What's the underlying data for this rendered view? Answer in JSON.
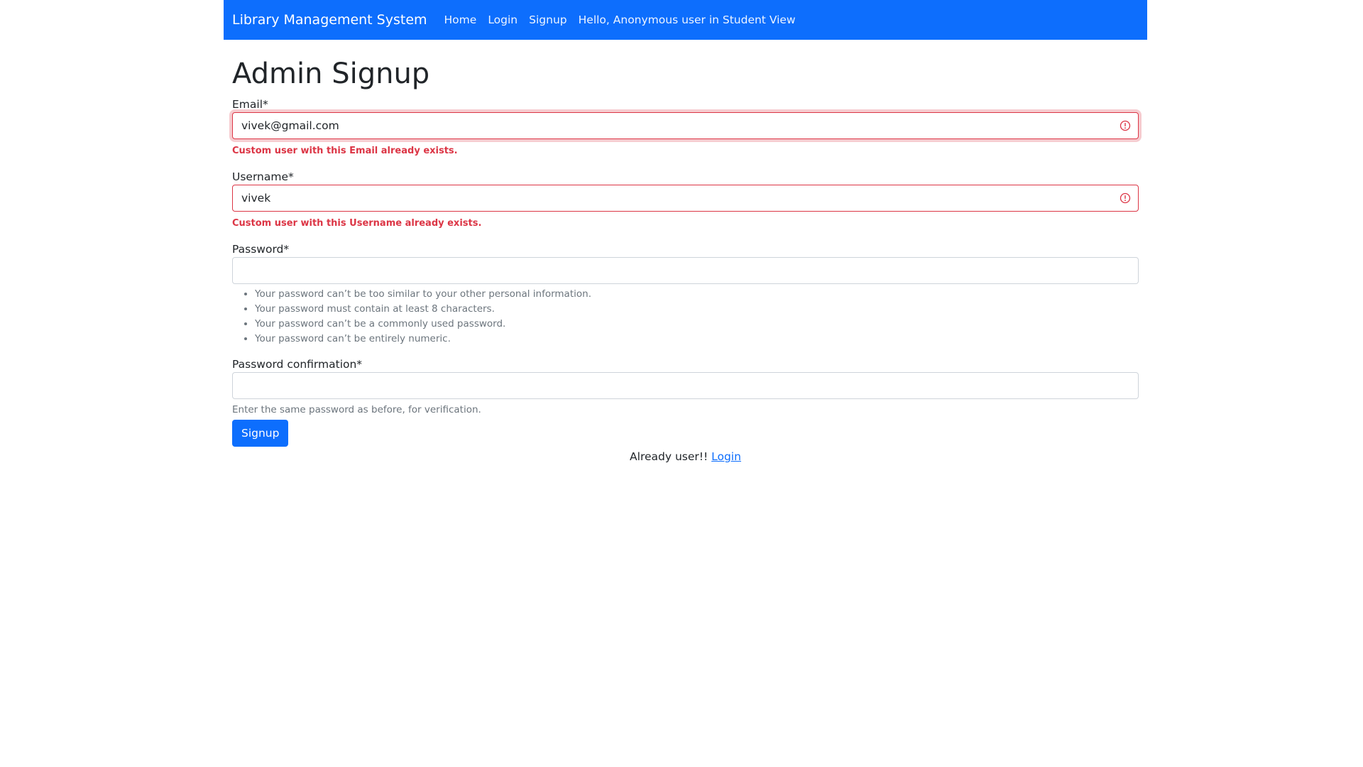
{
  "navbar": {
    "brand": "Library Management System",
    "links": [
      "Home",
      "Login",
      "Signup"
    ],
    "greeting": "Hello, Anonymous user in Student View"
  },
  "page_title": "Admin Signup",
  "form": {
    "email": {
      "label": "Email*",
      "value": "vivek@gmail.com",
      "error": "Custom user with this Email already exists."
    },
    "username": {
      "label": "Username*",
      "value": "vivek",
      "error": "Custom user with this Username already exists."
    },
    "password": {
      "label": "Password*",
      "value": "",
      "help": [
        "Your password can’t be too similar to your other personal information.",
        "Your password must contain at least 8 characters.",
        "Your password can’t be a commonly used password.",
        "Your password can’t be entirely numeric."
      ]
    },
    "password_confirmation": {
      "label": "Password confirmation*",
      "value": "",
      "help": "Enter the same password as before, for verification."
    },
    "submit_label": "Signup"
  },
  "footer": {
    "text": "Already user!!",
    "link": "Login"
  },
  "colors": {
    "primary": "#0d6efd",
    "danger": "#dc3545",
    "muted": "#6c757d"
  }
}
